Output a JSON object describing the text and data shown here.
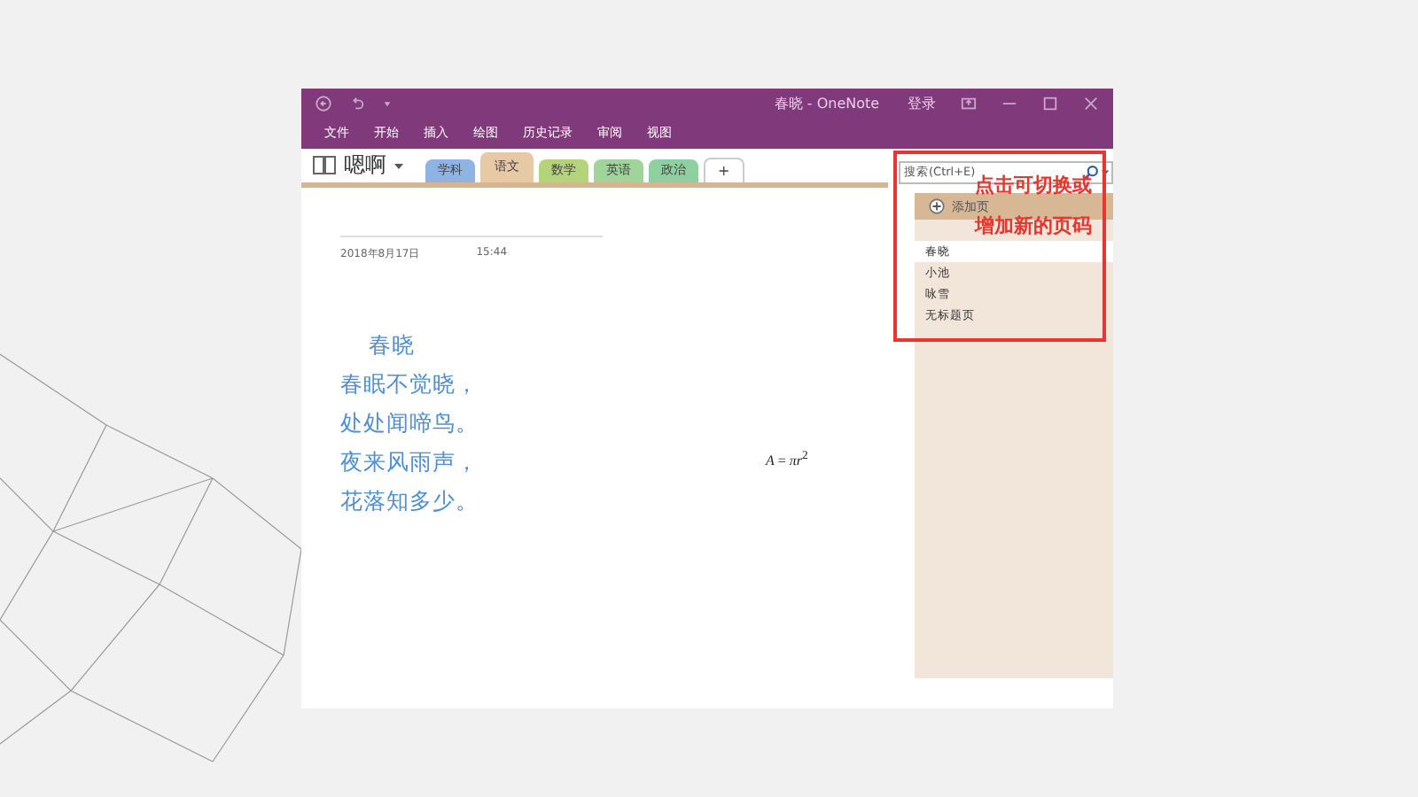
{
  "window": {
    "title": "春晓 - OneNote",
    "sign_in": "登录"
  },
  "menu": [
    "文件",
    "开始",
    "插入",
    "绘图",
    "历史记录",
    "审阅",
    "视图"
  ],
  "notebook": {
    "name": "嗯啊"
  },
  "sections": [
    {
      "label": "学科",
      "selected": false,
      "color": "#8db4e2"
    },
    {
      "label": "语文",
      "selected": true,
      "color": "#e8c9a6"
    },
    {
      "label": "数学",
      "selected": false,
      "color": "#b5d37a"
    },
    {
      "label": "英语",
      "selected": false,
      "color": "#9fd49a"
    },
    {
      "label": "政治",
      "selected": false,
      "color": "#8fd0a0"
    }
  ],
  "add_section": "+",
  "search": {
    "placeholder": "搜索(Ctrl+E)"
  },
  "add_page": "添加页",
  "pages": [
    {
      "title": "春晓",
      "selected": true
    },
    {
      "title": "小池",
      "selected": false
    },
    {
      "title": "咏雪",
      "selected": false
    },
    {
      "title": "无标题页",
      "selected": false
    }
  ],
  "page": {
    "date": "2018年8月17日",
    "time": "15:44",
    "lines": [
      "春晓",
      "春眠不觉晓，",
      "处处闻啼鸟。",
      "夜来风雨声，",
      "花落知多少。"
    ],
    "formula": "*A* = *πr*$^{2}$"
  },
  "annotation": {
    "lines": [
      "点击可切换或",
      "增加新的页码"
    ]
  }
}
